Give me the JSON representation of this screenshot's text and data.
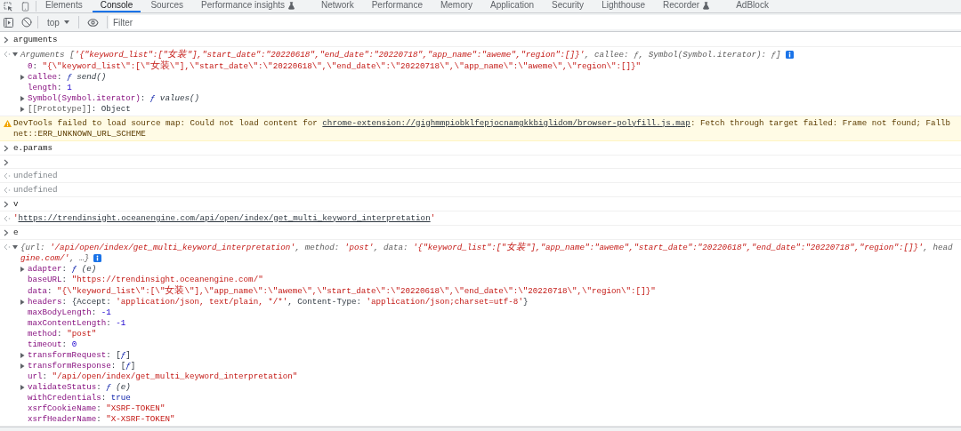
{
  "tabs": [
    {
      "label": "Elements",
      "selected": false,
      "experimental": false
    },
    {
      "label": "Console",
      "selected": true,
      "experimental": false
    },
    {
      "label": "Sources",
      "selected": false,
      "experimental": false
    },
    {
      "label": "Performance insights",
      "selected": false,
      "experimental": true
    },
    {
      "label": "Network",
      "selected": false,
      "experimental": false
    },
    {
      "label": "Performance",
      "selected": false,
      "experimental": false
    },
    {
      "label": "Memory",
      "selected": false,
      "experimental": false
    },
    {
      "label": "Application",
      "selected": false,
      "experimental": false
    },
    {
      "label": "Security",
      "selected": false,
      "experimental": false
    },
    {
      "label": "Lighthouse",
      "selected": false,
      "experimental": false
    },
    {
      "label": "Recorder",
      "selected": false,
      "experimental": true
    },
    {
      "label": "AdBlock",
      "selected": false,
      "experimental": false
    }
  ],
  "toolbar": {
    "context": "top",
    "filter_placeholder": "Filter"
  },
  "console": [
    {
      "kind": "input",
      "text": "arguments"
    },
    {
      "kind": "result",
      "tree": {
        "expanded": true,
        "info": true,
        "lines": [
          [
            {
              "kind": "preview",
              "text": "Arguments ["
            },
            {
              "kind": "preview_string",
              "text": "'{\"keyword_list\":[\"女装\"],\"start_date\":\"20220618\",\"end_date\":\"20220718\",\"app_name\":\"aweme\",\"region\":[]}'"
            },
            {
              "kind": "preview",
              "text": ", callee: ƒ, Symbol(Symbol.iterator): ƒ]"
            }
          ]
        ],
        "children": [
          {
            "lines": [
              [
                {
                  "kind": "key",
                  "text": "0"
                },
                {
                  "kind": "plain",
                  "text": ": "
                },
                {
                  "kind": "string",
                  "text": "\"{\\\"keyword_list\\\":[\\\"女装\\\"],\\\"start_date\\\":\\\"20220618\\\",\\\"end_date\\\":\\\"20220718\\\",\\\"app_name\\\":\\\"aweme\\\",\\\"region\\\":[]}\""
                }
              ]
            ]
          },
          {
            "expanded": false,
            "lines": [
              [
                {
                  "kind": "key",
                  "text": "callee"
                },
                {
                  "kind": "plain",
                  "text": ": "
                },
                {
                  "kind": "fn_mark",
                  "text": "ƒ"
                },
                {
                  "kind": "fn_name",
                  "text": " send()"
                }
              ]
            ]
          },
          {
            "lines": [
              [
                {
                  "kind": "key",
                  "text": "length"
                },
                {
                  "kind": "plain",
                  "text": ": "
                },
                {
                  "kind": "number",
                  "text": "1"
                }
              ]
            ]
          },
          {
            "expanded": false,
            "lines": [
              [
                {
                  "kind": "key",
                  "text": "Symbol(Symbol.iterator)"
                },
                {
                  "kind": "plain",
                  "text": ": "
                },
                {
                  "kind": "fn_mark",
                  "text": "ƒ"
                },
                {
                  "kind": "fn_name",
                  "text": " values()"
                }
              ]
            ]
          },
          {
            "expanded": false,
            "lines": [
              [
                {
                  "kind": "internal",
                  "text": "[[Prototype]]"
                },
                {
                  "kind": "plain",
                  "text": ": Object"
                }
              ]
            ]
          }
        ]
      }
    },
    {
      "kind": "warning",
      "lines": [
        [
          {
            "kind": "plain",
            "text": "DevTools failed to load source map: Could not load content for "
          },
          {
            "kind": "link",
            "text": "chrome-extension://gighmmpiobklfepjocnamgkkbiglidom/browser-polyfill.js.map"
          },
          {
            "kind": "plain",
            "text": ": Fetch through target failed: Frame not found; Fallb"
          }
        ],
        [
          {
            "kind": "plain",
            "text": "net::ERR_UNKNOWN_URL_SCHEME"
          }
        ]
      ]
    },
    {
      "kind": "input",
      "text": "e.params"
    },
    {
      "kind": "input"
    },
    {
      "kind": "result",
      "lines": [
        [
          {
            "kind": "undefined",
            "text": "undefined"
          }
        ]
      ]
    },
    {
      "kind": "result",
      "lines": [
        [
          {
            "kind": "undefined",
            "text": "undefined"
          }
        ]
      ]
    },
    {
      "kind": "input",
      "text": "v"
    },
    {
      "kind": "result",
      "lines": [
        [
          {
            "kind": "string",
            "text": "'"
          },
          {
            "kind": "link",
            "text": "https://trendinsight.oceanengine.com/api/open/index/get_multi_keyword_interpretation"
          },
          {
            "kind": "string",
            "text": "'"
          }
        ]
      ]
    },
    {
      "kind": "input",
      "text": "e"
    },
    {
      "kind": "result",
      "tree": {
        "expanded": true,
        "info": true,
        "lines": [
          [
            {
              "kind": "preview",
              "text": "{url: "
            },
            {
              "kind": "preview_string",
              "text": "'/api/open/index/get_multi_keyword_interpretation'"
            },
            {
              "kind": "preview",
              "text": ", method: "
            },
            {
              "kind": "preview_string",
              "text": "'post'"
            },
            {
              "kind": "preview",
              "text": ", data: "
            },
            {
              "kind": "preview_string",
              "text": "'{\"keyword_list\":[\"女装\"],\"app_name\":\"aweme\",\"start_date\":\"20220618\",\"end_date\":\"20220718\",\"region\":[]}'"
            },
            {
              "kind": "preview",
              "text": ", head"
            }
          ],
          [
            {
              "kind": "preview_string",
              "text": "gine.com/'"
            },
            {
              "kind": "preview",
              "text": ", …}"
            }
          ]
        ],
        "children": [
          {
            "expanded": false,
            "lines": [
              [
                {
                  "kind": "key",
                  "text": "adapter"
                },
                {
                  "kind": "plain",
                  "text": ": "
                },
                {
                  "kind": "fn_mark",
                  "text": "ƒ"
                },
                {
                  "kind": "fn_name",
                  "text": " (e)"
                }
              ]
            ]
          },
          {
            "lines": [
              [
                {
                  "kind": "key",
                  "text": "baseURL"
                },
                {
                  "kind": "plain",
                  "text": ": "
                },
                {
                  "kind": "string",
                  "text": "\"https://trendinsight.oceanengine.com/\""
                }
              ]
            ]
          },
          {
            "lines": [
              [
                {
                  "kind": "key",
                  "text": "data"
                },
                {
                  "kind": "plain",
                  "text": ": "
                },
                {
                  "kind": "string",
                  "text": "\"{\\\"keyword_list\\\":[\\\"女装\\\"],\\\"app_name\\\":\\\"aweme\\\",\\\"start_date\\\":\\\"20220618\\\",\\\"end_date\\\":\\\"20220718\\\",\\\"region\\\":[]}\""
                }
              ]
            ]
          },
          {
            "expanded": false,
            "lines": [
              [
                {
                  "kind": "key",
                  "text": "headers"
                },
                {
                  "kind": "plain",
                  "text": ": {Accept: "
                },
                {
                  "kind": "string",
                  "text": "'application/json, text/plain, */*'"
                },
                {
                  "kind": "plain",
                  "text": ", Content-Type: "
                },
                {
                  "kind": "string",
                  "text": "'application/json;charset=utf-8'"
                },
                {
                  "kind": "plain",
                  "text": "}"
                }
              ]
            ]
          },
          {
            "lines": [
              [
                {
                  "kind": "key",
                  "text": "maxBodyLength"
                },
                {
                  "kind": "plain",
                  "text": ": "
                },
                {
                  "kind": "number",
                  "text": "-1"
                }
              ]
            ]
          },
          {
            "lines": [
              [
                {
                  "kind": "key",
                  "text": "maxContentLength"
                },
                {
                  "kind": "plain",
                  "text": ": "
                },
                {
                  "kind": "number",
                  "text": "-1"
                }
              ]
            ]
          },
          {
            "lines": [
              [
                {
                  "kind": "key",
                  "text": "method"
                },
                {
                  "kind": "plain",
                  "text": ": "
                },
                {
                  "kind": "string",
                  "text": "\"post\""
                }
              ]
            ]
          },
          {
            "lines": [
              [
                {
                  "kind": "key",
                  "text": "timeout"
                },
                {
                  "kind": "plain",
                  "text": ": "
                },
                {
                  "kind": "number",
                  "text": "0"
                }
              ]
            ]
          },
          {
            "expanded": false,
            "lines": [
              [
                {
                  "kind": "key",
                  "text": "transformRequest"
                },
                {
                  "kind": "plain",
                  "text": ": ["
                },
                {
                  "kind": "fn_mark",
                  "text": "ƒ"
                },
                {
                  "kind": "plain",
                  "text": "]"
                }
              ]
            ]
          },
          {
            "expanded": false,
            "lines": [
              [
                {
                  "kind": "key",
                  "text": "transformResponse"
                },
                {
                  "kind": "plain",
                  "text": ": ["
                },
                {
                  "kind": "fn_mark",
                  "text": "ƒ"
                },
                {
                  "kind": "plain",
                  "text": "]"
                }
              ]
            ]
          },
          {
            "lines": [
              [
                {
                  "kind": "key",
                  "text": "url"
                },
                {
                  "kind": "plain",
                  "text": ": "
                },
                {
                  "kind": "string",
                  "text": "\"/api/open/index/get_multi_keyword_interpretation\""
                }
              ]
            ]
          },
          {
            "expanded": false,
            "lines": [
              [
                {
                  "kind": "key",
                  "text": "validateStatus"
                },
                {
                  "kind": "plain",
                  "text": ": "
                },
                {
                  "kind": "fn_mark",
                  "text": "ƒ"
                },
                {
                  "kind": "fn_name",
                  "text": " (e)"
                }
              ]
            ]
          },
          {
            "lines": [
              [
                {
                  "kind": "key",
                  "text": "withCredentials"
                },
                {
                  "kind": "plain",
                  "text": ": "
                },
                {
                  "kind": "bool",
                  "text": "true"
                }
              ]
            ]
          },
          {
            "lines": [
              [
                {
                  "kind": "key",
                  "text": "xsrfCookieName"
                },
                {
                  "kind": "plain",
                  "text": ": "
                },
                {
                  "kind": "string",
                  "text": "\"XSRF-TOKEN\""
                }
              ]
            ]
          },
          {
            "lines": [
              [
                {
                  "kind": "key",
                  "text": "xsrfHeaderName"
                },
                {
                  "kind": "plain",
                  "text": ": "
                },
                {
                  "kind": "string",
                  "text": "\"X-XSRF-TOKEN\""
                }
              ]
            ]
          }
        ]
      }
    }
  ]
}
